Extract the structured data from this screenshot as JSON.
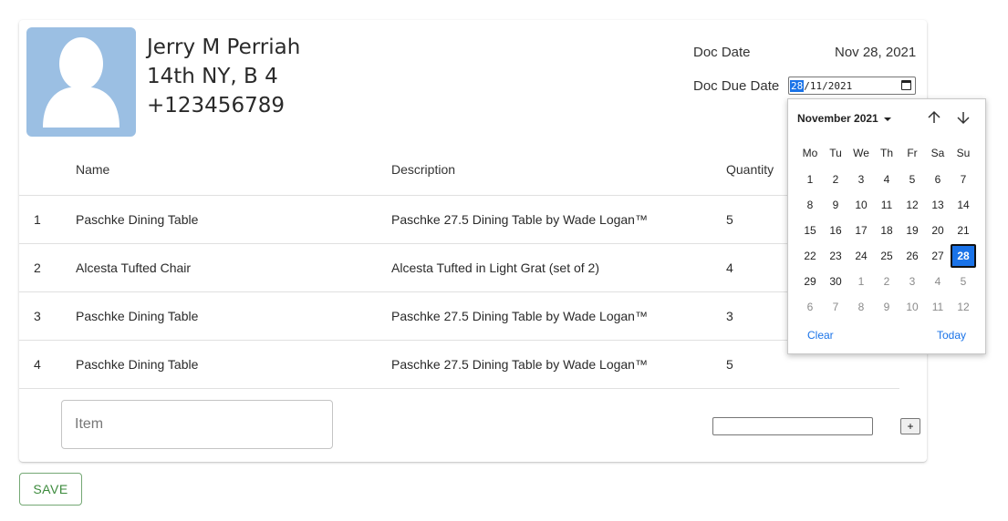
{
  "customer": {
    "name": "Jerry M Perriah",
    "address": "14th NY, B 4",
    "phone": "+123456789"
  },
  "doc": {
    "doc_date_label": "Doc Date",
    "doc_date_value": "Nov 28, 2021",
    "due_date_label": "Doc Due Date",
    "due_date_day": "28",
    "due_date_rest": "/11/2021"
  },
  "table": {
    "headers": [
      "Name",
      "Description",
      "Quantity"
    ],
    "rows": [
      {
        "index": "1",
        "name": "Paschke Dining Table",
        "description": "Paschke 27.5 Dining Table by Wade Logan™",
        "quantity": "5"
      },
      {
        "index": "2",
        "name": "Alcesta Tufted Chair",
        "description": "Alcesta Tufted in Light Grat (set of 2)",
        "quantity": "4"
      },
      {
        "index": "3",
        "name": "Paschke Dining Table",
        "description": "Paschke 27.5 Dining Table by Wade Logan™",
        "quantity": "3"
      },
      {
        "index": "4",
        "name": "Paschke Dining Table",
        "description": "Paschke 27.5 Dining Table by Wade Logan™",
        "quantity": "5"
      }
    ]
  },
  "add_row": {
    "item_placeholder": "Item",
    "plus_label": "+"
  },
  "save_label": "SAVE",
  "calendar": {
    "month_label": "November 2021",
    "weekdays": [
      "Mo",
      "Tu",
      "We",
      "Th",
      "Fr",
      "Sa",
      "Su"
    ],
    "weeks": [
      [
        "1",
        "2",
        "3",
        "4",
        "5",
        "6",
        "7"
      ],
      [
        "8",
        "9",
        "10",
        "11",
        "12",
        "13",
        "14"
      ],
      [
        "15",
        "16",
        "17",
        "18",
        "19",
        "20",
        "21"
      ],
      [
        "22",
        "23",
        "24",
        "25",
        "26",
        "27",
        "28"
      ],
      [
        "29",
        "30",
        "1",
        "2",
        "3",
        "4",
        "5"
      ],
      [
        "6",
        "7",
        "8",
        "9",
        "10",
        "11",
        "12"
      ]
    ],
    "selected_day": "28",
    "clear_label": "Clear",
    "today_label": "Today"
  },
  "colors": {
    "accent": "#1a73e8",
    "avatar_bg": "#9bbfe3",
    "save_green": "#3d8b3d"
  }
}
